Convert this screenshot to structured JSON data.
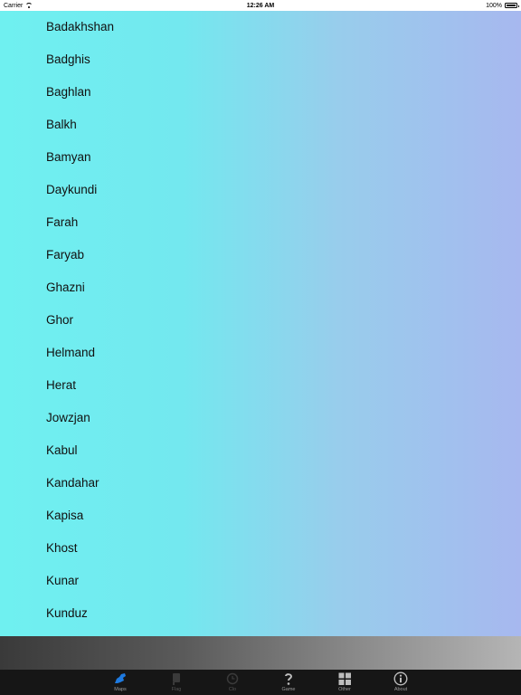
{
  "status_bar": {
    "carrier": "Carrier",
    "time": "12:26 AM",
    "battery": "100%"
  },
  "provinces": [
    "Badakhshan",
    "Badghis",
    "Baghlan",
    "Balkh",
    "Bamyan",
    "Daykundi",
    "Farah",
    "Faryab",
    "Ghazni",
    "Ghor",
    "Helmand",
    "Herat",
    "Jowzjan",
    "Kabul",
    "Kandahar",
    "Kapisa",
    "Khost",
    "Kunar",
    "Kunduz"
  ],
  "tabs": [
    {
      "label": "Maps",
      "icon": "map-icon",
      "state": "active"
    },
    {
      "label": "Flag",
      "icon": "flag-icon",
      "state": "dim"
    },
    {
      "label": "Clo",
      "icon": "clock-icon",
      "state": "dim"
    },
    {
      "label": "Game",
      "icon": "question-icon",
      "state": "normal"
    },
    {
      "label": "Other",
      "icon": "grid-icon",
      "state": "normal"
    },
    {
      "label": "About",
      "icon": "info-icon",
      "state": "normal"
    }
  ],
  "colors": {
    "accent": "#1e7ae0",
    "tab_bar": "#161616",
    "gradient_left": "#6ff0f0",
    "gradient_right": "#a7b8ef"
  }
}
